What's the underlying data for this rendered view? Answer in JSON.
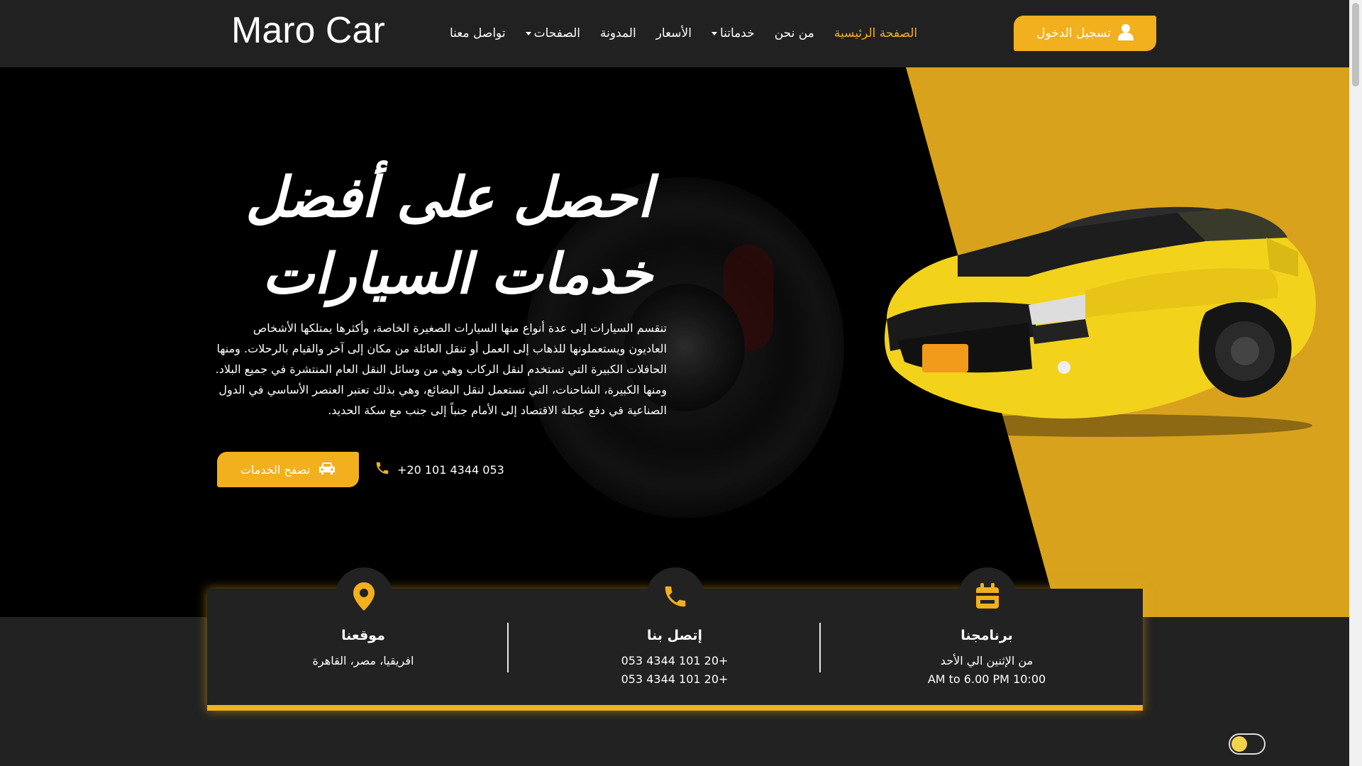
{
  "brand": "Maro Car",
  "nav": {
    "items": [
      {
        "label": "الصفحة الرئيسية",
        "active": true,
        "dropdown": false
      },
      {
        "label": "من نحن",
        "active": false,
        "dropdown": false
      },
      {
        "label": "خدماتنا",
        "active": false,
        "dropdown": true
      },
      {
        "label": "الأسعار",
        "active": false,
        "dropdown": false
      },
      {
        "label": "المدونة",
        "active": false,
        "dropdown": false
      },
      {
        "label": "الصفحات",
        "active": false,
        "dropdown": true
      },
      {
        "label": "تواصل معنا",
        "active": false,
        "dropdown": false
      }
    ],
    "login_label": "تسجيل الدخول",
    "login_icon": "user-icon"
  },
  "hero": {
    "title_line1": "احصل على أفضل",
    "title_line2": "خدمات السيارات",
    "text": "تنقسم السيارات إلى عدة أنواع منها السيارات الصغيرة الخاصة، وأكثرها يمتلكها الأشخاص العاديون ويستعملونها للذهاب إلى العمل أو تنقل العائلة من مكان إلى آخر والقيام بالرحلات. ومنها الحافلات الكبيرة التي تستخدم لنقل الركاب وهي من وسائل النقل العام المنتشرة في جميع البلاد. ومنها الكبيرة، الشاحنات، التي تستعمل لنقل البضائع، وهي بذلك تعتبر العنصر الأساسي في الدول الصناعية في دفع عجلة الاقتصاد إلى الأمام جنباً إلى جنب مع سكة الحديد.",
    "cta_label": "تصفح الخدمات",
    "cta_icon": "car-icon",
    "phone": "+20 101 4344 053",
    "phone_icon": "phone-icon"
  },
  "info": {
    "location": {
      "title": "موقعنا",
      "line1": "افريقيا، مصر، القاهرة",
      "icon": "map-pin-icon"
    },
    "contact": {
      "title": "إتصل بنا",
      "line1": "+20 101 4344 053",
      "line2": "+20 101 4344 053",
      "icon": "phone-icon"
    },
    "schedule": {
      "title": "برنامجنا",
      "line1": "من الإثنين الي الأحد",
      "line2": "10:00 AM to 6.00 PM",
      "icon": "calendar-icon"
    }
  },
  "colors": {
    "accent": "#f2b01e",
    "background": "#222222",
    "hero_bg": "#000000",
    "hero_panel": "#d8a21d"
  }
}
